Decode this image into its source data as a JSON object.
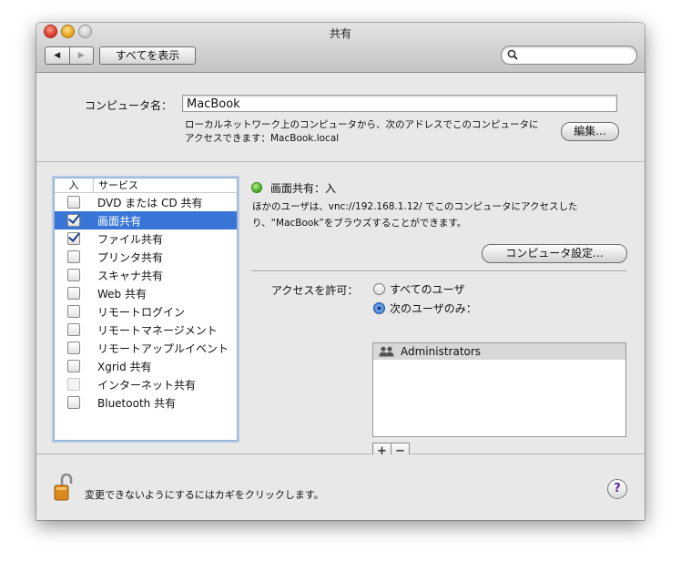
{
  "window": {
    "title": "共有",
    "back_label": "◀",
    "forward_label": "▶",
    "show_all_label": "すべてを表示",
    "search_placeholder": ""
  },
  "computer": {
    "name_label": "コンピュータ名：",
    "name_value": "MacBook",
    "address_line1": "ローカルネットワーク上のコンピュータから、次のアドレスでこのコンピュータに",
    "address_line2": "アクセスできます：MacBook.local",
    "edit_label": "編集..."
  },
  "services": {
    "header_on": "入",
    "header_service": "サービス",
    "items": [
      {
        "name": "DVD または CD 共有",
        "checked": false,
        "selected": false
      },
      {
        "name": "画面共有",
        "checked": true,
        "selected": true
      },
      {
        "name": "ファイル共有",
        "checked": true,
        "selected": false
      },
      {
        "name": "プリンタ共有",
        "checked": false,
        "selected": false
      },
      {
        "name": "スキャナ共有",
        "checked": false,
        "selected": false
      },
      {
        "name": "Web 共有",
        "checked": false,
        "selected": false
      },
      {
        "name": "リモートログイン",
        "checked": false,
        "selected": false
      },
      {
        "name": "リモートマネージメント",
        "checked": false,
        "selected": false
      },
      {
        "name": "リモートアップルイベント",
        "checked": false,
        "selected": false
      },
      {
        "name": "Xgrid 共有",
        "checked": false,
        "selected": false
      },
      {
        "name": "インターネット共有",
        "checked": false,
        "selected": false,
        "disabled": true
      },
      {
        "name": "Bluetooth 共有",
        "checked": false,
        "selected": false
      }
    ]
  },
  "detail": {
    "status": "画面共有：入",
    "status_color": "#3aa31a",
    "desc_line1": "ほかのユーザは、vnc://192.168.1.12/ でこのコンピュータにアクセスした",
    "desc_line2": "り、“MacBook”をブラウズすることができます。",
    "settings_label": "コンピュータ設定...",
    "access_label": "アクセスを許可：",
    "radio_all": "すべてのユーザ",
    "radio_only": "次のユーザのみ：",
    "users": [
      "Administrators"
    ],
    "plus_label": "+",
    "minus_label": "−"
  },
  "footer": {
    "lock_text": "変更できないようにするにはカギをクリックします。",
    "help_label": "?"
  }
}
